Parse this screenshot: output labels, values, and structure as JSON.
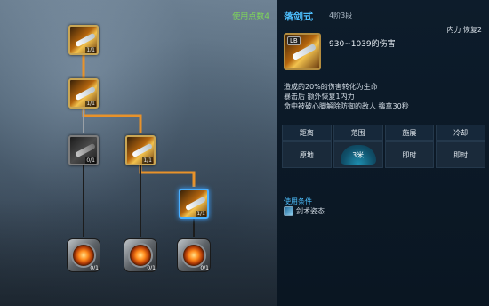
{
  "tree": {
    "points_label": "使用点数4",
    "nodes": [
      {
        "id": "n1",
        "level": "1/1",
        "state": "learned"
      },
      {
        "id": "n2",
        "level": "1/1",
        "state": "learned"
      },
      {
        "id": "n3",
        "level": "0/1",
        "state": "locked"
      },
      {
        "id": "n4",
        "level": "1/1",
        "state": "learned"
      },
      {
        "id": "n5",
        "level": "1/1",
        "state": "selected"
      },
      {
        "id": "r1",
        "level": "0/1",
        "state": "locked"
      },
      {
        "id": "r2",
        "level": "0/1",
        "state": "locked"
      },
      {
        "id": "r3",
        "level": "0/1",
        "state": "locked"
      }
    ]
  },
  "skill": {
    "name": "落剑式",
    "rank": "4阶3段",
    "inner_power": "内力 恢复2",
    "key": "LB",
    "damage": "930~1039的伤害",
    "effects": [
      "造成的20%的伤害转化为生命",
      "暴击后 额外恢复1内力",
      "命中被破心脚解除防御的敌人 擒拿30秒"
    ],
    "attributes": {
      "headers": [
        "距离",
        "范围",
        "施展",
        "冷却"
      ],
      "values": [
        "原地",
        "3米",
        "即时",
        "即时"
      ]
    },
    "condition": {
      "title": "使用条件",
      "item": "剑术姿态"
    }
  },
  "colors": {
    "accent_blue": "#4ec0ff",
    "points_green": "#7fd858",
    "connector_orange": "#e8922a"
  }
}
